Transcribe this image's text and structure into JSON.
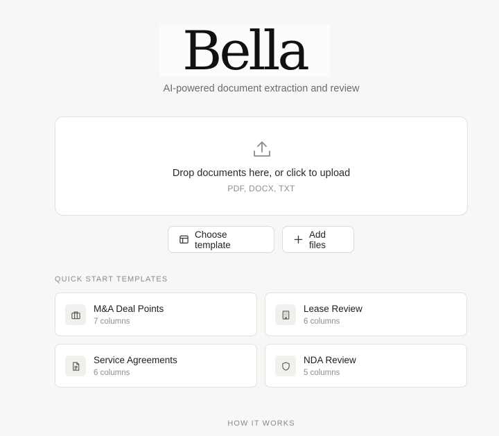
{
  "brand": {
    "logo_text": "Bella",
    "tagline": "AI-powered document extraction and review"
  },
  "upload": {
    "icon": "upload-icon",
    "title": "Drop documents here, or click to upload",
    "formats": "PDF, DOCX, TXT"
  },
  "actions": {
    "choose_template": {
      "label": "Choose template",
      "icon": "table-icon"
    },
    "add_files": {
      "label": "Add files",
      "icon": "plus-icon"
    }
  },
  "quick_start": {
    "heading": "QUICK START TEMPLATES",
    "templates": [
      {
        "title": "M&A Deal Points",
        "subtitle": "7 columns",
        "icon": "briefcase-icon"
      },
      {
        "title": "Lease Review",
        "subtitle": "6 columns",
        "icon": "building-icon"
      },
      {
        "title": "Service Agreements",
        "subtitle": "6 columns",
        "icon": "document-icon"
      },
      {
        "title": "NDA Review",
        "subtitle": "5 columns",
        "icon": "shield-icon"
      }
    ]
  },
  "how_it_works": {
    "heading": "HOW IT WORKS"
  }
}
